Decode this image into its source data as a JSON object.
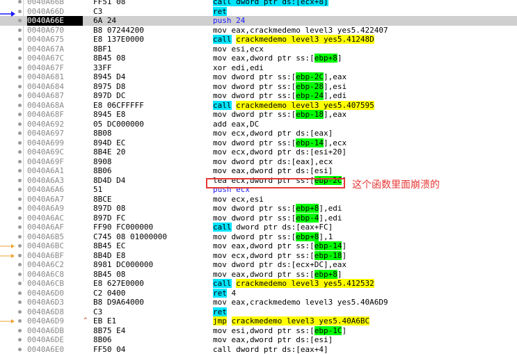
{
  "rows": [
    {
      "addr": "0040A66B",
      "bytes": "FF51 08",
      "asm": [
        {
          "t": "call dword ptr ds:[ecx+8]",
          "c": "call"
        }
      ]
    },
    {
      "addr": "0040A66D",
      "bytes": "C3",
      "asm": [
        {
          "t": "ret",
          "c": "ret"
        }
      ]
    },
    {
      "addr": "0040A66E",
      "bytes": "6A 24",
      "asm": [
        {
          "t": "push 24",
          "c": "push"
        }
      ],
      "selected": true
    },
    {
      "addr": "0040A670",
      "bytes": "B8 07244200",
      "asm": [
        {
          "t": "mov eax,crackmedemo level3 yes5.422407",
          "c": ""
        }
      ]
    },
    {
      "addr": "0040A675",
      "bytes": "E8 137E0000",
      "asm": [
        {
          "t": "call",
          "c": "call"
        },
        {
          "t": " ",
          "c": ""
        },
        {
          "t": "crackmedemo level3 yes5.41248D",
          "c": "tgt"
        }
      ]
    },
    {
      "addr": "0040A67A",
      "bytes": "8BF1",
      "asm": [
        {
          "t": "mov esi,ecx",
          "c": ""
        }
      ]
    },
    {
      "addr": "0040A67C",
      "bytes": "8B45 08",
      "asm": [
        {
          "t": "mov eax,dword ptr ss:[",
          "c": ""
        },
        {
          "t": "ebp+8",
          "c": "green"
        },
        {
          "t": "]",
          "c": ""
        }
      ]
    },
    {
      "addr": "0040A67F",
      "bytes": "33FF",
      "asm": [
        {
          "t": "xor edi,edi",
          "c": ""
        }
      ]
    },
    {
      "addr": "0040A681",
      "bytes": "8945 D4",
      "asm": [
        {
          "t": "mov dword ptr ss:[",
          "c": ""
        },
        {
          "t": "ebp-2C",
          "c": "green"
        },
        {
          "t": "],eax",
          "c": ""
        }
      ]
    },
    {
      "addr": "0040A684",
      "bytes": "8975 D8",
      "asm": [
        {
          "t": "mov dword ptr ss:[",
          "c": ""
        },
        {
          "t": "ebp-28",
          "c": "green"
        },
        {
          "t": "],esi",
          "c": ""
        }
      ]
    },
    {
      "addr": "0040A687",
      "bytes": "897D DC",
      "asm": [
        {
          "t": "mov dword ptr ss:[",
          "c": ""
        },
        {
          "t": "ebp-24",
          "c": "green"
        },
        {
          "t": "],edi",
          "c": ""
        }
      ]
    },
    {
      "addr": "0040A68A",
      "bytes": "E8 06CFFFFF",
      "asm": [
        {
          "t": "call",
          "c": "call"
        },
        {
          "t": " ",
          "c": ""
        },
        {
          "t": "crackmedemo level3 yes5.407595",
          "c": "tgt"
        }
      ]
    },
    {
      "addr": "0040A68F",
      "bytes": "8945 E8",
      "asm": [
        {
          "t": "mov dword ptr ss:[",
          "c": ""
        },
        {
          "t": "ebp-18",
          "c": "green"
        },
        {
          "t": "],eax",
          "c": ""
        }
      ]
    },
    {
      "addr": "0040A692",
      "bytes": "05 DC000000",
      "asm": [
        {
          "t": "add eax,DC",
          "c": ""
        }
      ]
    },
    {
      "addr": "0040A697",
      "bytes": "8B08",
      "asm": [
        {
          "t": "mov ecx,dword ptr ds:[eax]",
          "c": ""
        }
      ]
    },
    {
      "addr": "0040A699",
      "bytes": "894D EC",
      "asm": [
        {
          "t": "mov dword ptr ss:[",
          "c": ""
        },
        {
          "t": "ebp-14",
          "c": "green"
        },
        {
          "t": "],ecx",
          "c": ""
        }
      ]
    },
    {
      "addr": "0040A69C",
      "bytes": "8B4E 20",
      "asm": [
        {
          "t": "mov ecx,dword ptr ds:[esi+20]",
          "c": ""
        }
      ]
    },
    {
      "addr": "0040A69F",
      "bytes": "8908",
      "asm": [
        {
          "t": "mov dword ptr ds:[eax],ecx",
          "c": ""
        }
      ]
    },
    {
      "addr": "0040A6A1",
      "bytes": "8B06",
      "asm": [
        {
          "t": "mov eax,dword ptr ds:[esi]",
          "c": ""
        }
      ]
    },
    {
      "addr": "0040A6A3",
      "bytes": "8D4D D4",
      "asm": [
        {
          "t": "lea ecx,dword ptr ss:[",
          "c": ""
        },
        {
          "t": "ebp-2C",
          "c": "green"
        },
        {
          "t": "]",
          "c": ""
        }
      ]
    },
    {
      "addr": "0040A6A6",
      "bytes": "51",
      "asm": [
        {
          "t": "push ecx",
          "c": "push"
        }
      ]
    },
    {
      "addr": "0040A6A7",
      "bytes": "8BCE",
      "asm": [
        {
          "t": "mov ecx,esi",
          "c": ""
        }
      ]
    },
    {
      "addr": "0040A6A9",
      "bytes": "897D 08",
      "asm": [
        {
          "t": "mov dword ptr ss:[",
          "c": ""
        },
        {
          "t": "ebp+8",
          "c": "green"
        },
        {
          "t": "],edi",
          "c": ""
        }
      ]
    },
    {
      "addr": "0040A6AC",
      "bytes": "897D FC",
      "asm": [
        {
          "t": "mov dword ptr ss:[",
          "c": ""
        },
        {
          "t": "ebp-4",
          "c": "green"
        },
        {
          "t": "],edi",
          "c": ""
        }
      ]
    },
    {
      "addr": "0040A6AF",
      "bytes": "FF90 FC000000",
      "asm": [
        {
          "t": "call",
          "c": "call"
        },
        {
          "t": " dword ptr ds:[eax+FC]",
          "c": ""
        }
      ]
    },
    {
      "addr": "0040A6B5",
      "bytes": "C745 08 01000000",
      "asm": [
        {
          "t": "mov dword ptr ss:[",
          "c": ""
        },
        {
          "t": "ebp+8",
          "c": "green"
        },
        {
          "t": "],1",
          "c": ""
        }
      ]
    },
    {
      "addr": "0040A6BC",
      "bytes": "8B45 EC",
      "asm": [
        {
          "t": "mov eax,dword ptr ss:[",
          "c": ""
        },
        {
          "t": "ebp-14",
          "c": "green"
        },
        {
          "t": "]",
          "c": ""
        }
      ],
      "arrow": true
    },
    {
      "addr": "0040A6BF",
      "bytes": "8B4D E8",
      "asm": [
        {
          "t": "mov ecx,dword ptr ss:[",
          "c": ""
        },
        {
          "t": "ebp-18",
          "c": "green"
        },
        {
          "t": "]",
          "c": ""
        }
      ],
      "arrow": true
    },
    {
      "addr": "0040A6C2",
      "bytes": "8981 DC000000",
      "asm": [
        {
          "t": "mov dword ptr ds:[ecx+DC],eax",
          "c": ""
        }
      ]
    },
    {
      "addr": "0040A6C8",
      "bytes": "8B45 08",
      "asm": [
        {
          "t": "mov eax,dword ptr ss:[",
          "c": ""
        },
        {
          "t": "ebp+8",
          "c": "green"
        },
        {
          "t": "]",
          "c": ""
        }
      ]
    },
    {
      "addr": "0040A6CB",
      "bytes": "E8 627E0000",
      "asm": [
        {
          "t": "call",
          "c": "call"
        },
        {
          "t": " ",
          "c": ""
        },
        {
          "t": "crackmedemo level3 yes5.412532",
          "c": "tgt"
        }
      ]
    },
    {
      "addr": "0040A6D0",
      "bytes": "C2 0400",
      "asm": [
        {
          "t": "ret",
          "c": "ret"
        },
        {
          "t": " 4",
          "c": ""
        }
      ]
    },
    {
      "addr": "0040A6D3",
      "bytes": "B8 D9A64000",
      "asm": [
        {
          "t": "mov eax,crackmedemo level3 yes5.40A6D9",
          "c": ""
        }
      ]
    },
    {
      "addr": "0040A6D8",
      "bytes": "C3",
      "asm": [
        {
          "t": "ret",
          "c": "ret"
        }
      ]
    },
    {
      "addr": "0040A6D9",
      "bytes": "EB E1",
      "asm": [
        {
          "t": "jmp",
          "c": "jmp"
        },
        {
          "t": " ",
          "c": ""
        },
        {
          "t": "crackmedemo level3 yes5.40A6BC",
          "c": "tgt"
        }
      ],
      "jmpmark": "^",
      "arrow": true
    },
    {
      "addr": "0040A6DB",
      "bytes": "8B75 E4",
      "asm": [
        {
          "t": "mov esi,dword ptr ss:[",
          "c": ""
        },
        {
          "t": "ebp-1C",
          "c": "green"
        },
        {
          "t": "]",
          "c": ""
        }
      ]
    },
    {
      "addr": "0040A6DE",
      "bytes": "8B06",
      "asm": [
        {
          "t": "mov eax,dword ptr ds:[esi]",
          "c": ""
        }
      ]
    },
    {
      "addr": "0040A6E0",
      "bytes": "FF50 04",
      "asm": [
        {
          "t": "call dword ptr ds:[eax+4]",
          "c": ""
        }
      ]
    }
  ],
  "annotation": "这个函数里面崩溃的"
}
